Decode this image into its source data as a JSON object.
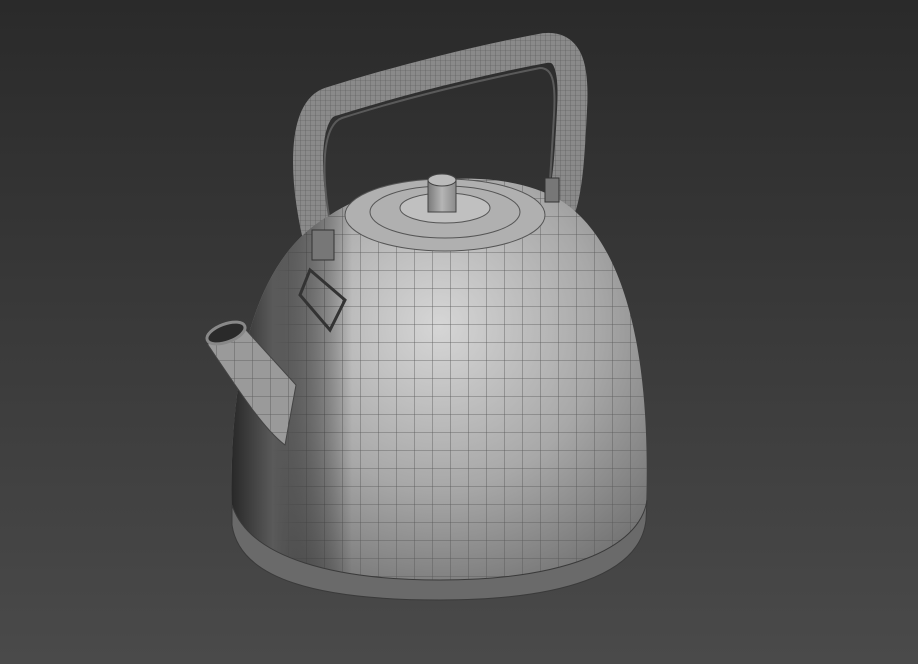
{
  "scene": {
    "object": "kettle",
    "render_mode": "shaded-wireframe"
  },
  "colors": {
    "background_top": "#2a2a2a",
    "background_bottom": "#4a4a4a",
    "surface_light": "#d8d8d8",
    "surface_mid": "#9a9a9a",
    "surface_dark": "#4a4a4a",
    "wire": "#5a5a5a"
  }
}
